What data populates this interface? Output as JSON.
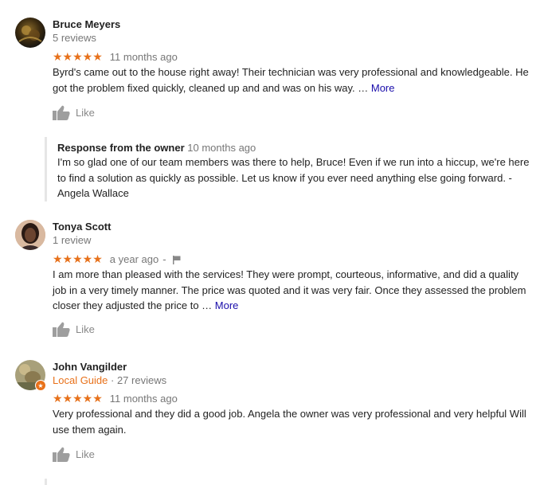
{
  "reviews": [
    {
      "name": "Bruce Meyers",
      "meta": "5 reviews",
      "stars": "★★★★★",
      "time": "11 months ago",
      "text": "Byrd's came out to the house right away! Their technician was very professional and knowledgeable. He got the problem fixed quickly, cleaned up and and was on his way. … ",
      "more": "More",
      "like": "Like",
      "owner_response": {
        "label": "Response from the owner",
        "time": "10 months ago",
        "text": "I'm so glad one of our team members was there to help, Bruce! Even if we run into a hiccup, we're here to find a solution as quickly as possible. Let us know if you ever need anything else going forward. - Angela Wallace"
      }
    },
    {
      "name": "Tonya Scott",
      "meta": "1 review",
      "stars": "★★★★★",
      "time": "a year ago",
      "separator": "-",
      "text": "I am more than pleased with the services! They were prompt, courteous, informative, and did a quality job in a very timely manner. The price was quoted and it was very fair. Once they assessed the problem closer they adjusted the price to … ",
      "more": "More",
      "like": "Like"
    },
    {
      "name": "John Vangilder",
      "guide": "Local Guide",
      "meta": " · 27 reviews",
      "stars": "★★★★★",
      "time": "11 months ago",
      "text": "Very professional and they did a good job.  Angela the owner was very professional and very helpful Will use them again.",
      "like": "Like"
    }
  ],
  "colors": {
    "star": "#e7711b",
    "link": "#1a0dab",
    "guide": "#e8711a"
  }
}
